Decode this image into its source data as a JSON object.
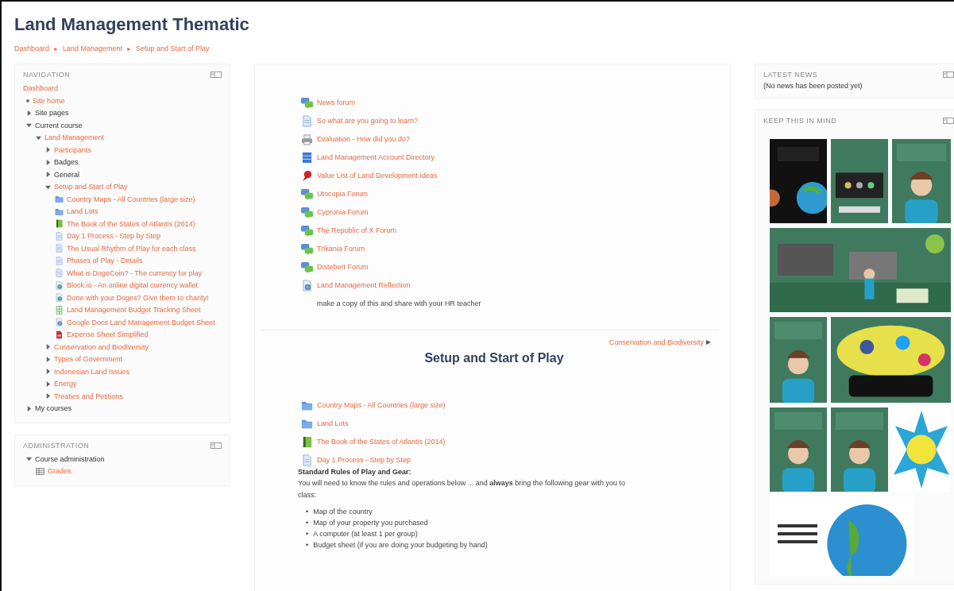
{
  "page_title": "Land Management Thematic",
  "breadcrumb": {
    "separator": "►",
    "items": [
      "Dashboard",
      "Land Management",
      "Setup and Start of Play"
    ]
  },
  "navigation": {
    "title": "NAVIGATION",
    "root": "Dashboard",
    "items": [
      {
        "label": "Site home",
        "link": true,
        "kind": "leaf"
      },
      {
        "label": "Site pages",
        "link": false,
        "kind": "branch",
        "expanded": false
      },
      {
        "label": "Current course",
        "link": false,
        "kind": "branch",
        "expanded": true,
        "children": [
          {
            "label": "Land Management",
            "link": true,
            "kind": "branch",
            "expanded": true,
            "children": [
              {
                "label": "Participants",
                "link": true,
                "kind": "branch",
                "expanded": false
              },
              {
                "label": "Badges",
                "link": false,
                "kind": "branch",
                "expanded": false
              },
              {
                "label": "General",
                "link": false,
                "kind": "branch",
                "expanded": false
              },
              {
                "label": "Setup and Start of Play",
                "link": true,
                "kind": "branch",
                "expanded": true,
                "children": [
                  {
                    "label": "Country Maps - All Countries (large size)",
                    "link": true,
                    "kind": "folder"
                  },
                  {
                    "label": "Land Lots",
                    "link": true,
                    "kind": "folder"
                  },
                  {
                    "label": "The Book of the States of Atlantis (2014)",
                    "link": true,
                    "kind": "book"
                  },
                  {
                    "label": "Day 1 Process - Step by Step",
                    "link": true,
                    "kind": "page"
                  },
                  {
                    "label": "The Usual Rhythm of Play for each class",
                    "link": true,
                    "kind": "page"
                  },
                  {
                    "label": "Phases of Play - Details",
                    "link": true,
                    "kind": "page"
                  },
                  {
                    "label": "What is DogeCoin? - The currency for play",
                    "link": true,
                    "kind": "page"
                  },
                  {
                    "label": "Block.io - An online digital currency wallet",
                    "link": true,
                    "kind": "url"
                  },
                  {
                    "label": "Done with your Doges? Give them to charity!",
                    "link": true,
                    "kind": "url"
                  },
                  {
                    "label": "Land Management Budget Tracking Sheet",
                    "link": true,
                    "kind": "sheet"
                  },
                  {
                    "label": "Google Docs Land Management Budget Sheet",
                    "link": true,
                    "kind": "url"
                  },
                  {
                    "label": "Expense Sheet Simplified",
                    "link": true,
                    "kind": "pdf"
                  }
                ]
              },
              {
                "label": "Conservation and Biodiversity",
                "link": true,
                "kind": "branch",
                "expanded": false
              },
              {
                "label": "Types of Government",
                "link": true,
                "kind": "branch",
                "expanded": false
              },
              {
                "label": "Indonesian Land Issues",
                "link": true,
                "kind": "branch",
                "expanded": false
              },
              {
                "label": "Energy",
                "link": true,
                "kind": "branch",
                "expanded": false
              },
              {
                "label": "Treaties and Petitions",
                "link": true,
                "kind": "branch",
                "expanded": false
              }
            ]
          }
        ]
      },
      {
        "label": "My courses",
        "link": false,
        "kind": "branch",
        "expanded": false
      }
    ]
  },
  "administration": {
    "title": "ADMINISTRATION",
    "items": [
      {
        "label": "Course administration",
        "link": false,
        "kind": "branch",
        "expanded": true,
        "children": [
          {
            "label": "Grades",
            "link": true,
            "kind": "grades"
          }
        ]
      }
    ]
  },
  "general_section": {
    "activities": [
      {
        "label": "News forum",
        "kind": "forum"
      },
      {
        "label": "So what are you going to learn?",
        "kind": "page"
      },
      {
        "label": "Evaluation - How did you do?",
        "kind": "quiz"
      },
      {
        "label": "Land Management Account Directory",
        "kind": "database"
      },
      {
        "label": "Value List of Land Development Ideas",
        "kind": "assign"
      },
      {
        "label": "Utocopia Forum",
        "kind": "forum"
      },
      {
        "label": "Cypronia Forum",
        "kind": "forum"
      },
      {
        "label": "The Republic of X Forum",
        "kind": "forum"
      },
      {
        "label": "Trikania Forum",
        "kind": "forum"
      },
      {
        "label": "Distebert Forum",
        "kind": "forum"
      },
      {
        "label": "Land Management Reflection",
        "kind": "url"
      }
    ],
    "note": "make a copy of this and share with your HR teacher"
  },
  "section": {
    "next_link": "Conservation and Biodiversity",
    "title": "Setup and Start of Play",
    "activities": [
      {
        "label": "Country Maps - All Countries (large size)",
        "kind": "folder"
      },
      {
        "label": "Land Lots",
        "kind": "folder"
      },
      {
        "label": "The Book of the States of Atlantis (2014)",
        "kind": "book"
      },
      {
        "label": "Day 1 Process - Step by Step",
        "kind": "page"
      }
    ],
    "rules_heading": "Standard Rules of Play and Gear:",
    "rules_text": "You will need to know the rules and operations below ... and **always** bring the following gear with you to class:",
    "gear_bullet": "•",
    "gear": [
      "Map of the country",
      "Map of your property you purchased",
      "A computer (at least 1 per group)",
      "Budget sheet (if you are doing your budgeting by hand)"
    ]
  },
  "latest_news": {
    "title": "LATEST NEWS",
    "text": "(No news has been posted yet)"
  },
  "keep_in_mind": {
    "title": "KEEP THIS IN MIND"
  }
}
